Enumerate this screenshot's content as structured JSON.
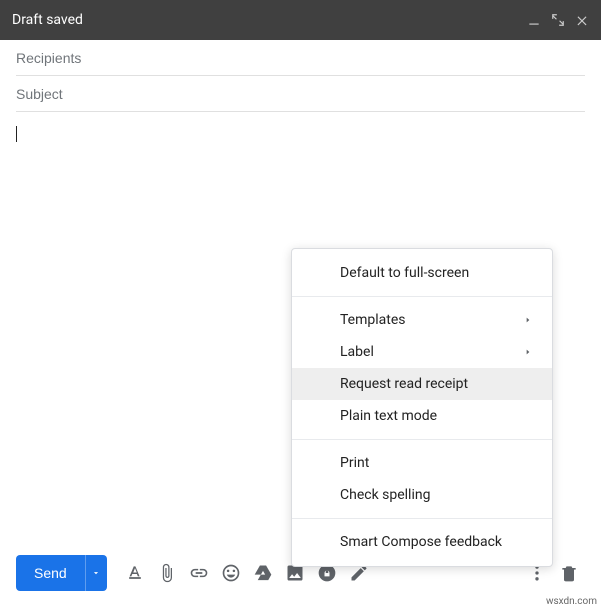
{
  "header": {
    "title": "Draft saved"
  },
  "fields": {
    "recipients_placeholder": "Recipients",
    "recipients_value": "",
    "subject_placeholder": "Subject",
    "subject_value": ""
  },
  "body": {
    "content": ""
  },
  "toolbar": {
    "send_label": "Send"
  },
  "menu": {
    "default_fullscreen": "Default to full-screen",
    "templates": "Templates",
    "label": "Label",
    "request_read_receipt": "Request read receipt",
    "plain_text": "Plain text mode",
    "print": "Print",
    "check_spelling": "Check spelling",
    "smart_compose": "Smart Compose feedback"
  },
  "watermark": "wsxdn.com"
}
